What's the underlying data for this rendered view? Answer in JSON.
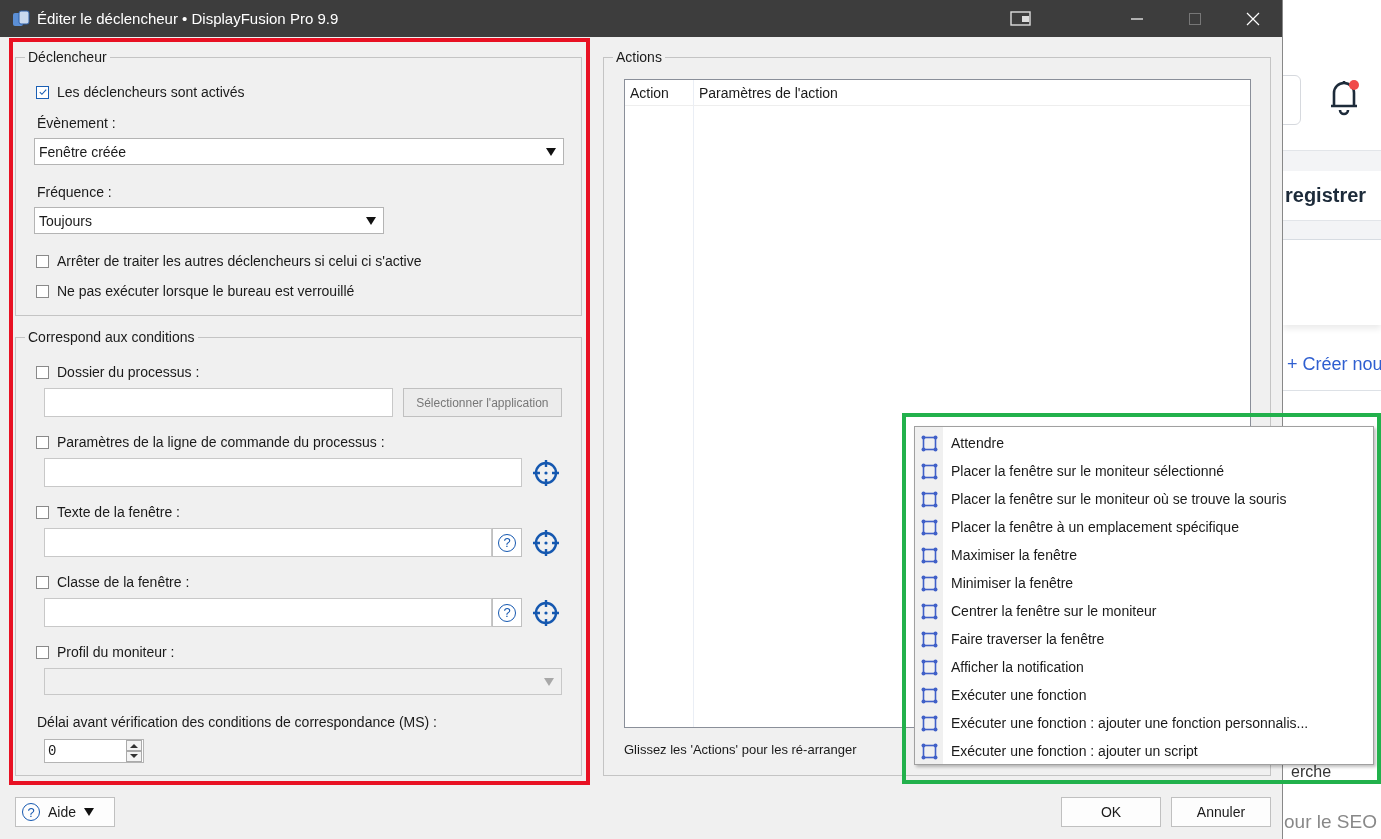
{
  "window": {
    "title": "Éditer le déclencheur • DisplayFusion Pro 9.9"
  },
  "trigger_group": {
    "legend": "Déclencheur",
    "enabled": {
      "label": "Les déclencheurs sont activés",
      "checked": true
    },
    "event": {
      "label": "Évènement :",
      "value": "Fenêtre créée"
    },
    "frequency": {
      "label": "Fréquence :",
      "value": "Toujours"
    },
    "options": [
      {
        "label": "Arrêter de traiter les autres déclencheurs si celui ci s'active",
        "checked": false
      },
      {
        "label": "Ne pas exécuter lorsque le bureau est verrouillé",
        "checked": false
      }
    ]
  },
  "conditions_group": {
    "legend": "Correspond aux conditions",
    "conditions": [
      {
        "kind": "text",
        "label": "Dossier du processus :",
        "checked": false,
        "button": "Sélectionner l'application",
        "button_disabled": true,
        "picker": false
      },
      {
        "kind": "text",
        "label": "Paramètres de la ligne de commande du processus :",
        "checked": false,
        "picker": true
      },
      {
        "kind": "text",
        "label": "Texte de la fenêtre :",
        "checked": false,
        "help_button": "?",
        "picker": true
      },
      {
        "kind": "text",
        "label": "Classe de la fenêtre :",
        "checked": false,
        "help_button": "?",
        "picker": true
      },
      {
        "kind": "dropdown",
        "label": "Profil du moniteur :",
        "checked": false,
        "disabled": true
      }
    ],
    "delay": {
      "label": "Délai avant vérification des conditions de correspondance (MS) :",
      "value": "0"
    }
  },
  "actions_group": {
    "legend": "Actions",
    "columns": [
      "Action",
      "Paramètres de l'action"
    ],
    "hint": "Glissez les 'Actions' pour les ré-arranger"
  },
  "footer": {
    "help": {
      "icon": "?",
      "label": "Aide"
    },
    "ok": "OK",
    "cancel": "Annuler"
  },
  "action_menu": {
    "items": [
      "Attendre",
      "Placer la fenêtre sur le moniteur sélectionné",
      "Placer la fenêtre sur le moniteur où se trouve la souris",
      "Placer la fenêtre à un emplacement spécifique",
      "Maximiser la fenêtre",
      "Minimiser la fenêtre",
      "Centrer la fenêtre sur le moniteur",
      "Faire traverser la fenêtre",
      "Afficher la notification",
      "Exécuter une fonction",
      "Exécuter une fonction : ajouter une fonction personnalis...",
      "Exécuter une fonction : ajouter un script"
    ]
  },
  "background_page": {
    "bell": {
      "unread": true
    },
    "texts": [
      {
        "kind": "button",
        "text": "registrer"
      },
      {
        "kind": "link",
        "text": "+ Créer nou"
      },
      {
        "kind": "text",
        "text": "erche"
      },
      {
        "kind": "muted",
        "text": "our le SEO"
      }
    ]
  },
  "highlights": [
    {
      "color": "#e81123"
    },
    {
      "color": "#22b14c"
    }
  ]
}
